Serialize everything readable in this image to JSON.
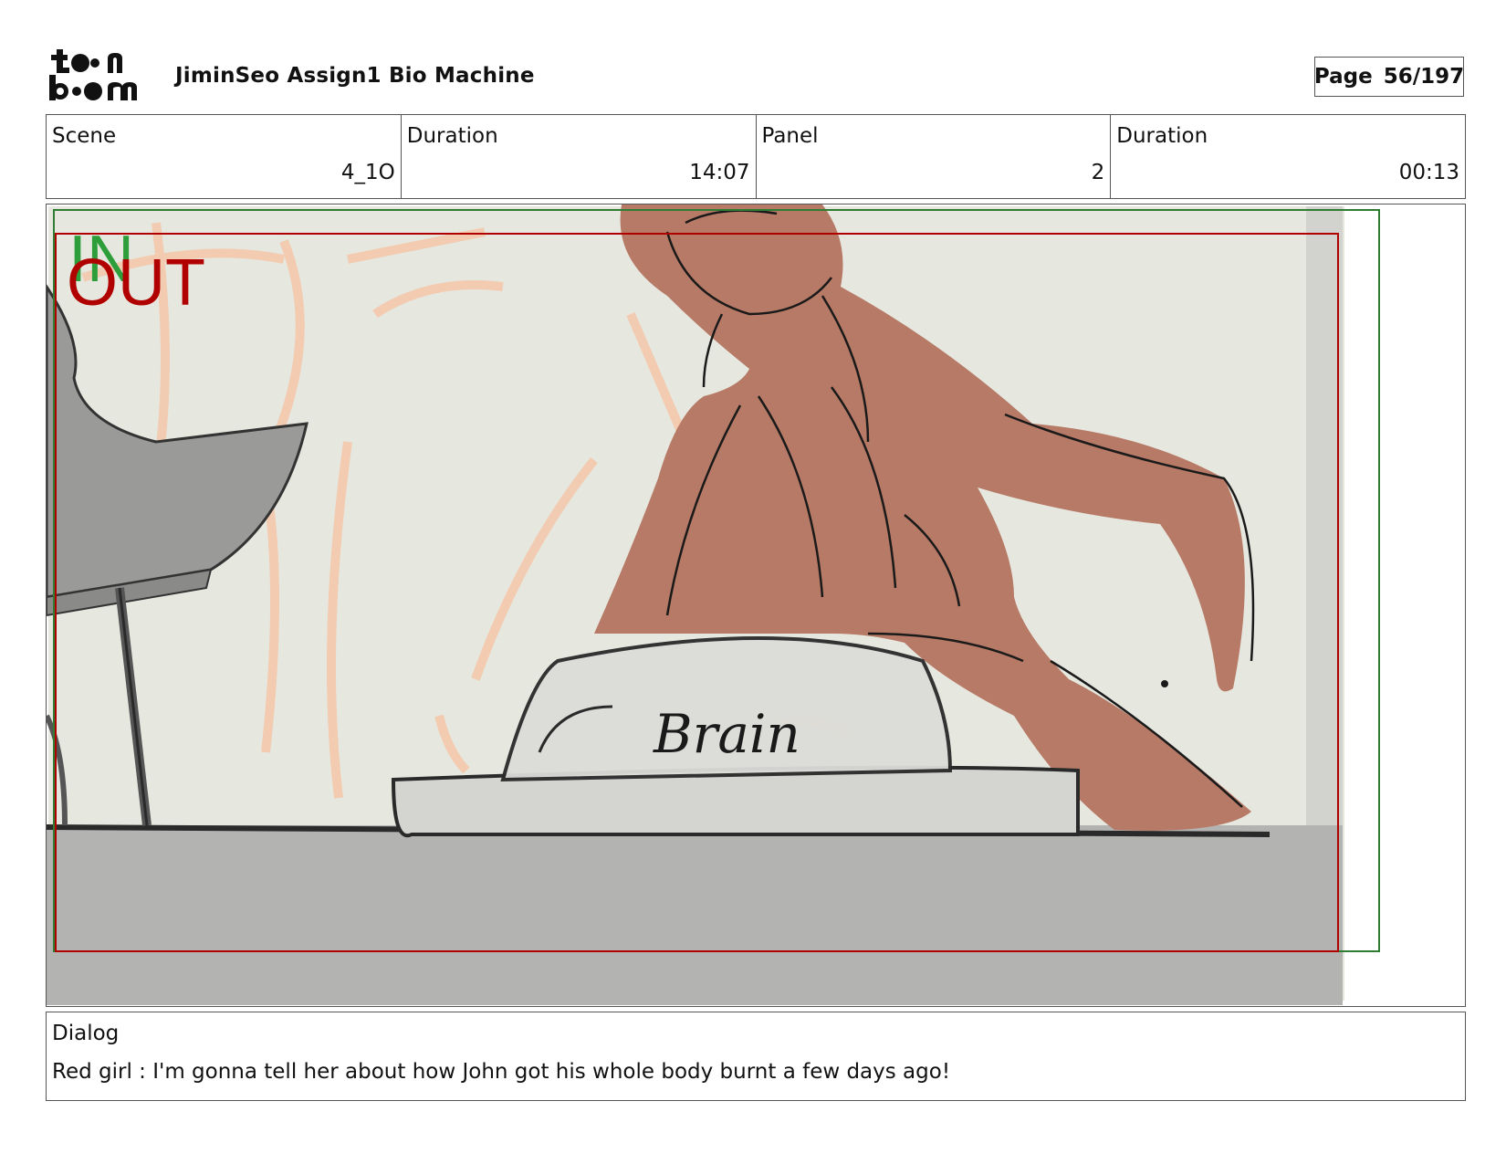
{
  "header": {
    "logo_text": "toon boom",
    "project_title": "JiminSeo Assign1 Bio Machine",
    "page_label": "Page",
    "page_value": "56/197"
  },
  "info": {
    "scene_label": "Scene",
    "scene_value": "4_1O",
    "scene_duration_label": "Duration",
    "scene_duration_value": "14:07",
    "panel_label": "Panel",
    "panel_value": "2",
    "panel_duration_label": "Duration",
    "panel_duration_value": "00:13"
  },
  "panel_image": {
    "in_label": "IN",
    "out_label": "OUT",
    "sketch_text": "Brain",
    "colors": {
      "in_frame": "#2e7d32",
      "out_frame": "#b00000",
      "character_fill": "#b77a66",
      "background": "#e6e8e0",
      "table": "#b3b3b1"
    }
  },
  "dialog": {
    "label": "Dialog",
    "text": "Red girl : I'm gonna tell her about how John got his whole body burnt a few days ago!"
  }
}
